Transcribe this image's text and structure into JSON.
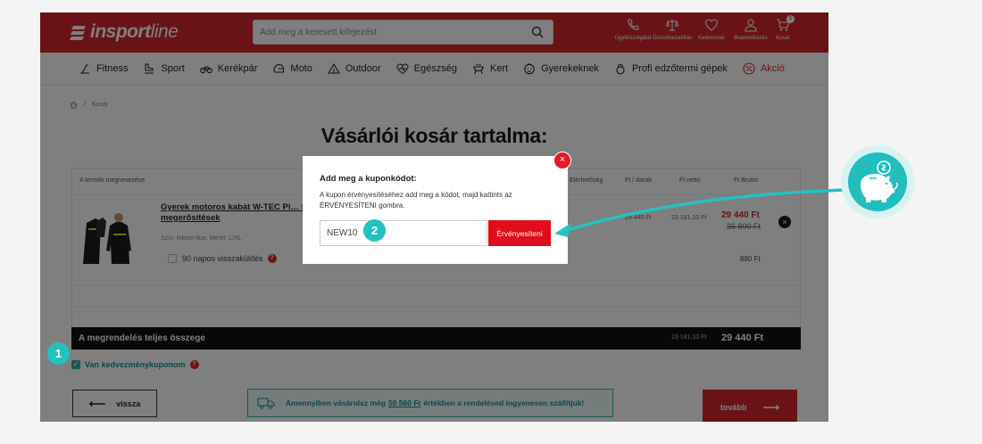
{
  "header": {
    "logo_text_a": "in",
    "logo_text_b": "sport",
    "logo_text_c": "line",
    "search_placeholder": "Add meg a keresett kifejezést",
    "icons": [
      {
        "label": "Ügyfélszolgálat",
        "icon": "phone-icon"
      },
      {
        "label": "Összehasonlítás",
        "icon": "scales-icon"
      },
      {
        "label": "Kedvencek",
        "icon": "heart-icon"
      },
      {
        "label": "Bejelentkezés",
        "icon": "user-icon"
      },
      {
        "label": "Kosár",
        "icon": "cart-icon"
      }
    ],
    "cart_count": "1"
  },
  "nav": [
    {
      "label": "Fitness",
      "icon": "treadmill-icon"
    },
    {
      "label": "Sport",
      "icon": "skate-icon"
    },
    {
      "label": "Kerékpár",
      "icon": "bicycle-icon"
    },
    {
      "label": "Moto",
      "icon": "helmet-icon"
    },
    {
      "label": "Outdoor",
      "icon": "tent-icon"
    },
    {
      "label": "Egészség",
      "icon": "heart-pulse-icon"
    },
    {
      "label": "Kert",
      "icon": "grill-icon"
    },
    {
      "label": "Gyerekeknek",
      "icon": "child-face-icon"
    },
    {
      "label": "Profi edzőtermi gépek",
      "icon": "kettlebell-icon"
    },
    {
      "label": "Akció",
      "icon": "percent-icon"
    }
  ],
  "breadcrumb": {
    "sep": "/",
    "current": "Kosár"
  },
  "page_title": "Vásárlói kosár tartalma:",
  "table": {
    "headers": {
      "product": "A termék megnevezése",
      "availability": "Elérhetőség",
      "unit_price": "Ft / darab",
      "net": "Ft nettó",
      "gross": "Ft Bruttó"
    },
    "item": {
      "name": "Gyerek motoros kabát W-TEC Pi… fényvisszaverő elemek, előkészít… megerősítések",
      "variant": "Szín: fekete-fluo, Méret: L/XL",
      "unit_price": "29 440 Ft",
      "net": "23 181,10 Ft",
      "price": "29 440 Ft",
      "old_price": "36 800 Ft",
      "return_option": "90 napos visszaküldés",
      "return_price": "880 Ft"
    }
  },
  "total": {
    "label": "A megrendelés teljes összege",
    "net": "23 181,10 Ft",
    "gross": "29 440 Ft"
  },
  "coupon_checkbox_label": "Van kedvezménykuponom",
  "buttons": {
    "back": "vissza",
    "next": "tovább"
  },
  "free_shipping": {
    "pre": "Amennyiben vásárolsz még",
    "amount": "50 560 Ft",
    "post": "értékben a rendelésed ingyenesen szállítjuk!"
  },
  "modal": {
    "title": "Add meg a kuponkódot:",
    "description": "A kupon érvényesítéséhez add meg a kódot, majd kattints az ÉRVÉNYESÍTENI gombra.",
    "input_value": "NEW10",
    "button": "Érvényesíteni",
    "close": "×"
  },
  "steps": {
    "one": "1",
    "two": "2"
  },
  "colors": {
    "brand": "#d4262c",
    "accent": "#25c1c1",
    "button_red": "#e00d1a"
  }
}
